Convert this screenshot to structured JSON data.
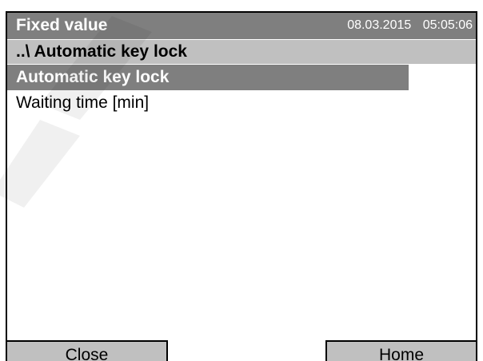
{
  "header": {
    "title": "Fixed value",
    "date": "08.03.2015",
    "time": "05:05:06"
  },
  "breadcrumb": {
    "path": "..\\ Automatic key lock"
  },
  "menu": {
    "items": [
      {
        "label": "Automatic key lock",
        "selected": true
      },
      {
        "label": "Waiting time [min]",
        "selected": false
      }
    ]
  },
  "softkeys": {
    "left_label": "Close",
    "right_label": "Home"
  },
  "colors": {
    "title_bar": "#7f7f7f",
    "path_bar": "#c0c0c0",
    "selection": "#7f7f7f",
    "button": "#c0c0c0"
  }
}
